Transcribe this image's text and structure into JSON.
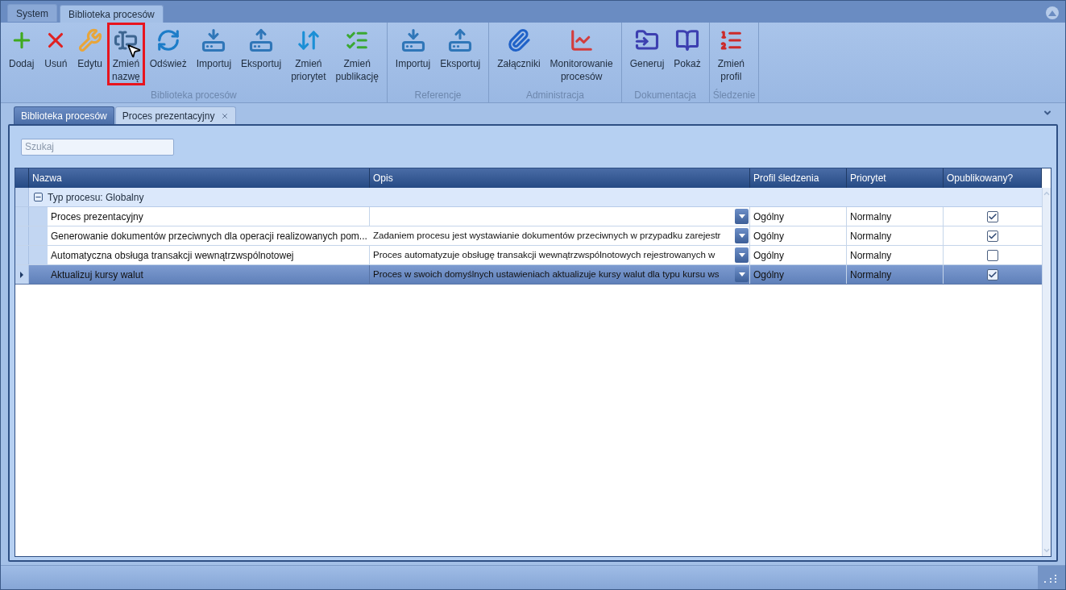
{
  "app_tabs": [
    {
      "label": "System",
      "selected": false
    },
    {
      "label": "Biblioteka procesów",
      "selected": true
    }
  ],
  "ribbon": {
    "groups": [
      {
        "label": "Biblioteka procesów",
        "buttons": [
          {
            "label": "Dodaj",
            "kind": "add",
            "highlighted": false
          },
          {
            "label": "Usuń",
            "kind": "delete",
            "highlighted": false
          },
          {
            "label": "Edytu",
            "kind": "edit",
            "highlighted": false
          },
          {
            "label": "Zmień nazwę",
            "kind": "rename",
            "highlighted": true
          },
          {
            "label": "Odśwież",
            "kind": "refresh",
            "highlighted": false
          },
          {
            "label": "Importuj",
            "kind": "import",
            "highlighted": false
          },
          {
            "label": "Eksportuj",
            "kind": "export",
            "highlighted": false
          },
          {
            "label": "Zmień priorytet",
            "kind": "priority",
            "highlighted": false
          },
          {
            "label": "Zmień publikację",
            "kind": "publish",
            "highlighted": false
          }
        ]
      },
      {
        "label": "Referencje",
        "buttons": [
          {
            "label": "Importuj",
            "kind": "import",
            "highlighted": false
          },
          {
            "label": "Eksportuj",
            "kind": "export",
            "highlighted": false
          }
        ]
      },
      {
        "label": "Administracja",
        "buttons": [
          {
            "label": "Załączniki",
            "kind": "attachments",
            "highlighted": false
          },
          {
            "label": "Monitorowanie procesów",
            "kind": "monitor",
            "highlighted": false
          }
        ]
      },
      {
        "label": "Dokumentacja",
        "buttons": [
          {
            "label": "Generuj",
            "kind": "generate",
            "highlighted": false
          },
          {
            "label": "Pokaż",
            "kind": "show",
            "highlighted": false
          }
        ]
      },
      {
        "label": "Śledzenie",
        "buttons": [
          {
            "label": "Zmień profil",
            "kind": "profile",
            "highlighted": false
          }
        ]
      }
    ]
  },
  "document_tabs": [
    {
      "label": "Biblioteka procesów",
      "selected": true,
      "closable": false
    },
    {
      "label": "Proces prezentacyjny",
      "selected": false,
      "closable": true
    }
  ],
  "search": {
    "placeholder": "Szukaj"
  },
  "table": {
    "columns": [
      "Nazwa",
      "Opis",
      "Profil śledzenia",
      "Priorytet",
      "Opublikowany?"
    ],
    "group": {
      "label": "Typ procesu: Globalny",
      "expanded": true
    },
    "rows": [
      {
        "name": "Proces prezentacyjny",
        "description": "",
        "profile": "Ogólny",
        "priority": "Normalny",
        "published": true,
        "selected": false
      },
      {
        "name": "Generowanie dokumentów przeciwnych dla operacji realizowanych pom...",
        "description": "Zadaniem procesu jest wystawianie dokumentów przeciwnych w przypadku zarejestr",
        "profile": "Ogólny",
        "priority": "Normalny",
        "published": true,
        "selected": false
      },
      {
        "name": "Automatyczna obsługa transakcji wewnątrzwspólnotowej",
        "description": "Proces automatyzuje obsługę transakcji wewnątrzwspólnotowych rejestrowanych w",
        "profile": "Ogólny",
        "priority": "Normalny",
        "published": false,
        "selected": false
      },
      {
        "name": "Aktualizuj kursy walut",
        "description": "Proces w swoich domyślnych ustawieniach aktualizuje kursy walut dla typu kursu ws",
        "profile": "Ogólny",
        "priority": "Normalny",
        "published": true,
        "selected": true
      }
    ]
  }
}
